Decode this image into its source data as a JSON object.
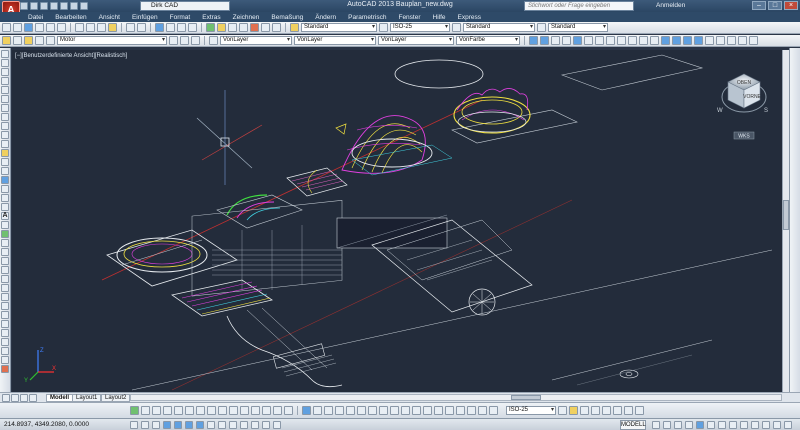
{
  "window": {
    "title": "AutoCAD 2013   Bauplan_new.dwg",
    "workspace": "Dirk CAD",
    "search_placeholder": "Stichwort oder Frage eingeben",
    "signin": "Anmelden",
    "logo_letter": "A"
  },
  "menu": [
    "Datei",
    "Bearbeiten",
    "Ansicht",
    "Einfügen",
    "Format",
    "Extras",
    "Zeichnen",
    "Bemaßung",
    "Ändern",
    "Parametrisch",
    "Fenster",
    "Hilfe",
    "Express"
  ],
  "toolbar1": {
    "textstyle": "Standard",
    "dimstyle": "ISO-25",
    "tablestyle": "Standard",
    "mleaderstyle": "Standard"
  },
  "toolbar2": {
    "layer": "Motor",
    "color": "VonLayer",
    "linetype": "VonLayer",
    "lineweight": "VonLayer",
    "plotstyle": "VonFarbe"
  },
  "viewport": {
    "label": "[−][Benutzerdefinierte Ansicht][Realistisch]",
    "viewcube_face": "VORNE",
    "viewcube_top": "OBEN",
    "viewcube_wcs": "WKS",
    "compass_w": "W",
    "compass_s": "S",
    "ucs_x": "X",
    "ucs_y": "Y",
    "ucs_z": "Z"
  },
  "tabs": [
    "Modell",
    "Layout1",
    "Layout2"
  ],
  "active_tab": "Modell",
  "toolrow": {
    "dimstyle": "ISO-25"
  },
  "status": {
    "coords": "214.8937, 4349.2080, 0.0000",
    "model": "MODELL"
  },
  "colors": {
    "titlebar": "#2b4663",
    "canvas": "#232c3b",
    "accent_red": "#d83a2a",
    "line_white": "#e8ecf0",
    "magenta": "#e040e0",
    "yellow": "#f0e040",
    "cyan": "#40d0e0"
  }
}
